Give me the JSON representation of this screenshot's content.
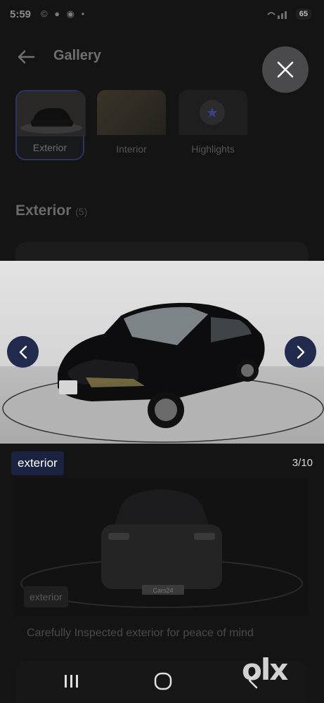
{
  "status_bar": {
    "time": "5:59",
    "notification_icons": "© ● ◉ •",
    "battery": "65"
  },
  "header": {
    "title": "Gallery"
  },
  "tabs": [
    {
      "label": "Exterior",
      "active": true
    },
    {
      "label": "Interior",
      "active": false
    },
    {
      "label": "Highlights",
      "active": false
    }
  ],
  "section": {
    "title": "Exterior",
    "count": "(5)"
  },
  "viewer": {
    "caption": "exterior",
    "counter": "3/10"
  },
  "card": {
    "badge": "exterior",
    "caption": "Carefully Inspected exterior for peace of mind",
    "plate": "Cars24"
  },
  "watermark": {
    "text": "olx"
  },
  "colors": {
    "accent": "#222a4d",
    "badge": "#1b2240"
  }
}
